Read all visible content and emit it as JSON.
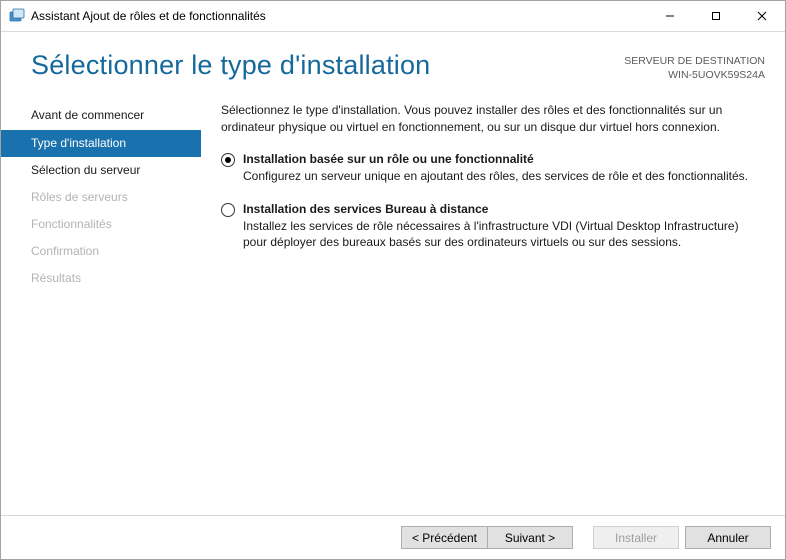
{
  "window": {
    "title": "Assistant Ajout de rôles et de fonctionnalités"
  },
  "header": {
    "page_title": "Sélectionner le type d'installation",
    "destination_label": "SERVEUR DE DESTINATION",
    "destination_value": "WIN-5UOVK59S24A"
  },
  "sidebar": {
    "steps": [
      {
        "label": "Avant de commencer",
        "state": "done"
      },
      {
        "label": "Type d'installation",
        "state": "active"
      },
      {
        "label": "Sélection du serveur",
        "state": "done"
      },
      {
        "label": "Rôles de serveurs",
        "state": "disabled"
      },
      {
        "label": "Fonctionnalités",
        "state": "disabled"
      },
      {
        "label": "Confirmation",
        "state": "disabled"
      },
      {
        "label": "Résultats",
        "state": "disabled"
      }
    ]
  },
  "content": {
    "intro": "Sélectionnez le type d'installation. Vous pouvez installer des rôles et des fonctionnalités sur un ordinateur physique ou virtuel en fonctionnement, ou sur un disque dur virtuel hors connexion.",
    "options": [
      {
        "selected": true,
        "title": "Installation basée sur un rôle ou une fonctionnalité",
        "desc": "Configurez un serveur unique en ajoutant des rôles, des services de rôle et des fonctionnalités."
      },
      {
        "selected": false,
        "title": "Installation des services Bureau à distance",
        "desc": "Installez les services de rôle nécessaires à l'infrastructure VDI (Virtual Desktop Infrastructure) pour déployer des bureaux basés sur des ordinateurs virtuels ou sur des sessions."
      }
    ]
  },
  "footer": {
    "previous": "< Précédent",
    "next": "Suivant >",
    "install": "Installer",
    "cancel": "Annuler"
  }
}
